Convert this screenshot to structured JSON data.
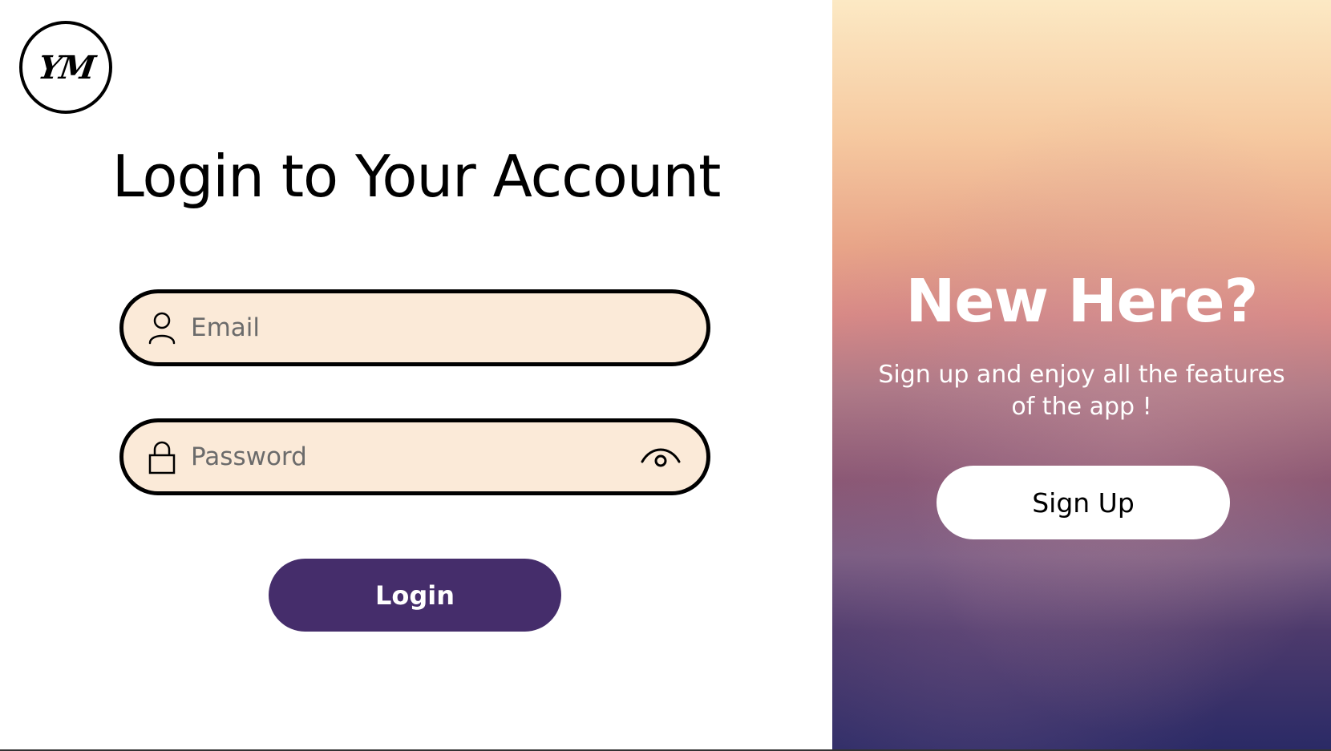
{
  "logo": {
    "text": "YM"
  },
  "login": {
    "title": "Login to Your Account",
    "email": {
      "placeholder": "Email",
      "value": "",
      "icon": "user-icon"
    },
    "password": {
      "placeholder": "Password",
      "value": "",
      "icon": "lock-icon",
      "toggle_icon": "eye-icon"
    },
    "submit_label": "Login",
    "submit_color": "#452d6b",
    "field_background": "#fbead8"
  },
  "signup_panel": {
    "title": "New Here?",
    "subtitle": "Sign up and enjoy all the features of the app !",
    "button_label": "Sign Up",
    "gradient_top": "#fce9c4",
    "gradient_bottom": "#2a2a66"
  }
}
